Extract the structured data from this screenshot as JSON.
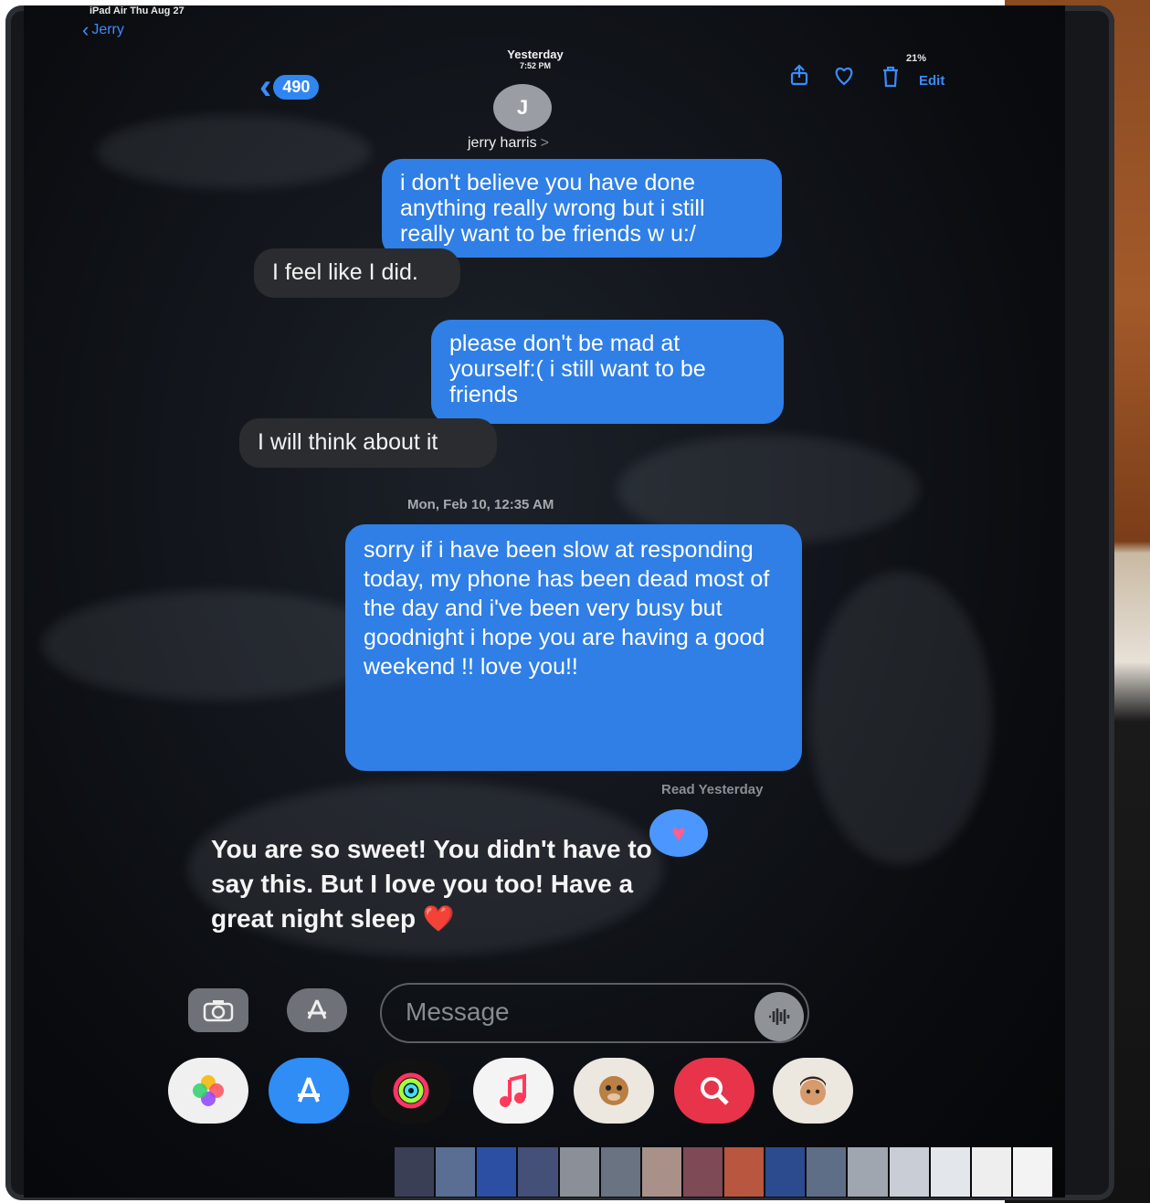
{
  "status_bar": {
    "left_text": "iPad Air  Thu Aug 27",
    "battery": "21%"
  },
  "header": {
    "back_label": "Jerry",
    "unread_count": "490",
    "date_line1": "Yesterday",
    "date_line2": "7:52 PM",
    "avatar_initial": "J",
    "contact_name": "jerry harris",
    "contact_chevron": ">",
    "edit_label": "Edit",
    "icons": [
      "share-icon",
      "heart-icon",
      "trash-icon"
    ]
  },
  "messages": [
    {
      "type": "sent",
      "text": "i don't believe you have done anything really wrong but i still really want to be friends w u:/"
    },
    {
      "type": "received",
      "text": "I feel like I did."
    },
    {
      "type": "sent",
      "text": "please don't be mad at yourself:( i still want to be friends"
    },
    {
      "type": "received",
      "text": "I will think about it"
    },
    {
      "type": "timestamp",
      "text": "Mon, Feb 10, 12:35 AM"
    },
    {
      "type": "sent",
      "text": "sorry if i have been slow at responding today, my phone has been dead most of the day and i've been very busy but goodnight i hope you are having a good weekend !! love you!!"
    },
    {
      "type": "status",
      "text": "Read Yesterday"
    },
    {
      "type": "received",
      "text": "You are so sweet! You didn't have to say this. But I love you too! Have a great night sleep ❤️"
    }
  ],
  "input_bar": {
    "placeholder": "Message",
    "icons": [
      "camera-icon",
      "app-store-icon",
      "audio-icon"
    ]
  },
  "app_drawer": [
    "photos-icon",
    "app-store-icon",
    "activity-icon",
    "music-icon",
    "animoji-icon",
    "search-icon",
    "memoji-icon"
  ],
  "colors": {
    "sent_bubble": "#2f7fe6",
    "received_bubble": "#2a2c30",
    "accent": "#3b8cff",
    "background": "#0a0c10"
  }
}
